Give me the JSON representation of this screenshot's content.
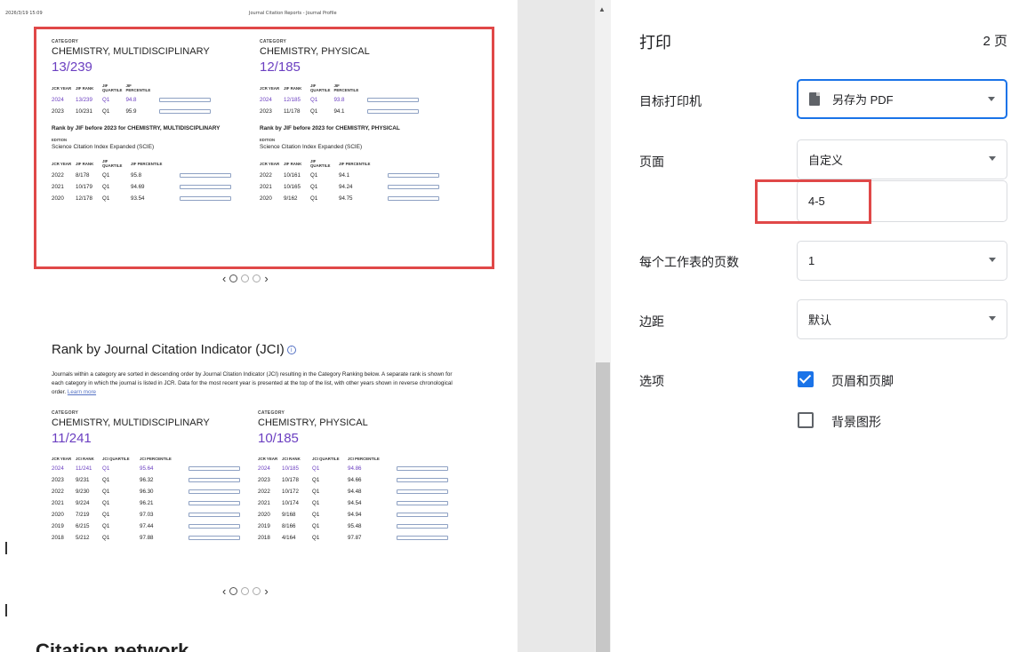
{
  "preview": {
    "header_timestamp": "2026/3/19 15:09",
    "header_title": "Journal Citation Reports - Journal Profile",
    "jif_left": {
      "category_label": "CATEGORY",
      "category": "CHEMISTRY, MULTIDISCIPLINARY",
      "rank": "13/239",
      "headers": [
        "JCR YEAR",
        "JIF RANK",
        "JIF QUARTILE",
        "JIF PERCENTILE"
      ],
      "rows": [
        {
          "year": "2024",
          "rank": "13/239",
          "q": "Q1",
          "pct": "94.8"
        },
        {
          "year": "2023",
          "rank": "10/231",
          "q": "Q1",
          "pct": "95.9"
        }
      ],
      "before_title": "Rank by JIF before 2023 for CHEMISTRY, MULTIDISCIPLINARY",
      "edition_label": "EDITION",
      "edition": "Science Citation Index Expanded (SCIE)",
      "before_headers": [
        "JCR YEAR",
        "JIF RANK",
        "JIF QUARTILE",
        "JIF PERCENTILE"
      ],
      "before_rows": [
        {
          "year": "2022",
          "rank": "8/178",
          "q": "Q1",
          "pct": "95.8"
        },
        {
          "year": "2021",
          "rank": "10/179",
          "q": "Q1",
          "pct": "94.69"
        },
        {
          "year": "2020",
          "rank": "12/178",
          "q": "Q1",
          "pct": "93.54"
        }
      ]
    },
    "jif_right": {
      "category_label": "CATEGORY",
      "category": "CHEMISTRY, PHYSICAL",
      "rank": "12/185",
      "headers": [
        "JCR YEAR",
        "JIF RANK",
        "JIF QUARTILE",
        "JIF PERCENTILE"
      ],
      "rows": [
        {
          "year": "2024",
          "rank": "12/185",
          "q": "Q1",
          "pct": "93.8"
        },
        {
          "year": "2023",
          "rank": "11/178",
          "q": "Q1",
          "pct": "94.1"
        }
      ],
      "before_title": "Rank by JIF before 2023 for CHEMISTRY, PHYSICAL",
      "edition_label": "EDITION",
      "edition": "Science Citation Index Expanded (SCIE)",
      "before_headers": [
        "JCR YEAR",
        "JIF RANK",
        "JIF QUARTILE",
        "JIF PERCENTILE"
      ],
      "before_rows": [
        {
          "year": "2022",
          "rank": "10/161",
          "q": "Q1",
          "pct": "94.1"
        },
        {
          "year": "2021",
          "rank": "10/165",
          "q": "Q1",
          "pct": "94.24"
        },
        {
          "year": "2020",
          "rank": "9/162",
          "q": "Q1",
          "pct": "94.75"
        }
      ]
    },
    "jci_section": {
      "title": "Rank by Journal Citation Indicator (JCI)",
      "info_glyph": "i",
      "description": "Journals within a category are sorted in descending order by Journal Citation Indicator (JCI) resulting in the Category Ranking below. A separate rank is shown for each category in which the journal is listed in JCR. Data for the most recent year is presented at the top of the list, with other years shown in reverse chronological order.",
      "learn_more": "Learn more"
    },
    "jci_left": {
      "category_label": "CATEGORY",
      "category": "CHEMISTRY, MULTIDISCIPLINARY",
      "rank": "11/241",
      "headers": [
        "JCR YEAR",
        "JCI RANK",
        "JCI QUARTILE",
        "JCI PERCENTILE"
      ],
      "rows": [
        {
          "year": "2024",
          "rank": "11/241",
          "q": "Q1",
          "pct": "95.64"
        },
        {
          "year": "2023",
          "rank": "9/231",
          "q": "Q1",
          "pct": "96.32"
        },
        {
          "year": "2022",
          "rank": "9/230",
          "q": "Q1",
          "pct": "96.30"
        },
        {
          "year": "2021",
          "rank": "9/224",
          "q": "Q1",
          "pct": "96.21"
        },
        {
          "year": "2020",
          "rank": "7/219",
          "q": "Q1",
          "pct": "97.03"
        },
        {
          "year": "2019",
          "rank": "6/215",
          "q": "Q1",
          "pct": "97.44"
        },
        {
          "year": "2018",
          "rank": "5/212",
          "q": "Q1",
          "pct": "97.88"
        }
      ]
    },
    "jci_right": {
      "category_label": "CATEGORY",
      "category": "CHEMISTRY, PHYSICAL",
      "rank": "10/185",
      "headers": [
        "JCR YEAR",
        "JCI RANK",
        "JCI QUARTILE",
        "JCI PERCENTILE"
      ],
      "rows": [
        {
          "year": "2024",
          "rank": "10/185",
          "q": "Q1",
          "pct": "94.86"
        },
        {
          "year": "2023",
          "rank": "10/178",
          "q": "Q1",
          "pct": "94.66"
        },
        {
          "year": "2022",
          "rank": "10/172",
          "q": "Q1",
          "pct": "94.48"
        },
        {
          "year": "2021",
          "rank": "10/174",
          "q": "Q1",
          "pct": "94.54"
        },
        {
          "year": "2020",
          "rank": "9/168",
          "q": "Q1",
          "pct": "94.94"
        },
        {
          "year": "2019",
          "rank": "8/166",
          "q": "Q1",
          "pct": "95.48"
        },
        {
          "year": "2018",
          "rank": "4/164",
          "q": "Q1",
          "pct": "97.87"
        }
      ]
    },
    "pager_prev": "‹",
    "pager_next": "›",
    "citation_title": "Citation network"
  },
  "settings": {
    "title": "打印",
    "page_count": "2 页",
    "destination_label": "目标打印机",
    "destination_value": "另存为 PDF",
    "pages_label": "页面",
    "pages_value": "自定义",
    "pages_range": "4-5",
    "pages_per_sheet_label": "每个工作表的页数",
    "pages_per_sheet_value": "1",
    "margins_label": "边距",
    "margins_value": "默认",
    "options_label": "选项",
    "option_headers_footers": "页眉和页脚",
    "option_headers_footers_checked": true,
    "option_background": "背景图形",
    "option_background_checked": false
  },
  "colors": {
    "accent_purple": "#6b3fc1",
    "highlight_red": "#e04848",
    "focus_blue": "#1a73e8"
  }
}
